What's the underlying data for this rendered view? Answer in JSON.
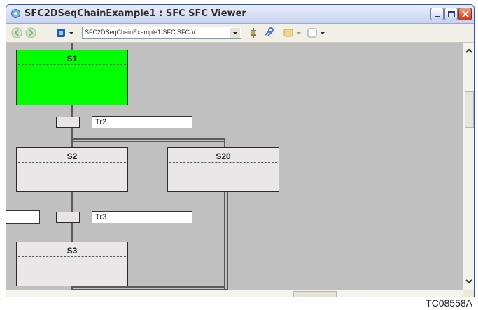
{
  "window": {
    "title": "SFC2DSeqChainExample1 : SFC SFC Viewer"
  },
  "toolbar": {
    "path_value": "SFC2DSeqChainExample1:SFC SFC V"
  },
  "diagram": {
    "steps": [
      {
        "name": "S1",
        "active": true
      },
      {
        "name": "S2",
        "active": false
      },
      {
        "name": "S20",
        "active": false
      },
      {
        "name": "S3",
        "active": false
      }
    ],
    "transitions": [
      {
        "name": "Tr2"
      },
      {
        "name": "Tr3"
      }
    ]
  },
  "figure": {
    "caption": "TC08558A"
  },
  "colors": {
    "active_step": "#00ff00",
    "canvas": "#c0c0c0"
  }
}
